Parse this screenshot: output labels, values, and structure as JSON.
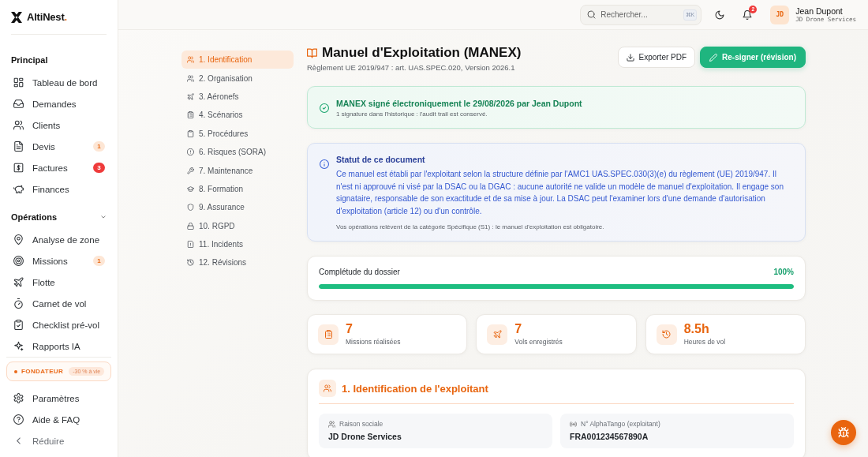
{
  "sidebar": {
    "logo": {
      "name": "AltiNest",
      "dot": "."
    },
    "sections": [
      {
        "title": "Principal",
        "items": [
          {
            "label": "Tableau de bord",
            "selected": false
          },
          {
            "label": "Demandes",
            "selected": false
          },
          {
            "label": "Clients",
            "selected": false
          },
          {
            "label": "Devis",
            "selected": false,
            "badge": {
              "text": "1",
              "color": "#fde6d5"
            }
          },
          {
            "label": "Factures",
            "selected": false,
            "badge": {
              "text": "3",
              "color": "#ef3b3b"
            }
          },
          {
            "label": "Finances",
            "selected": false
          }
        ]
      },
      {
        "title": "Opérations",
        "expanded": true,
        "items": [
          {
            "label": "Analyse de zone",
            "selected": false
          },
          {
            "label": "Missions",
            "selected": false,
            "badge": {
              "text": "1",
              "color": "#fde6d5"
            }
          },
          {
            "label": "Flotte",
            "selected": false
          },
          {
            "label": "Carnet de vol",
            "selected": false
          },
          {
            "label": "Checklist pré-vol",
            "selected": false
          },
          {
            "label": "Rapports IA",
            "selected": false
          }
        ]
      }
    ],
    "promo": {
      "label": "FONDATEUR",
      "tag": "-30 % à vie"
    },
    "footer": [
      {
        "label": "Paramètres",
        "selected": false
      },
      {
        "label": "Aide & FAQ",
        "selected": false
      },
      {
        "label": "Réduire",
        "selected": false
      }
    ]
  },
  "topbar": {
    "search": {
      "placeholder": "Rechercher...",
      "shortcut": "⌘K"
    },
    "notifications": "2",
    "user": {
      "initials": "JD",
      "name": "Jean Dupont",
      "company": "JD Drone Services"
    }
  },
  "doc_nav": [
    {
      "label": "1. Identification",
      "selected": true
    },
    {
      "label": "2. Organisation",
      "selected": false
    },
    {
      "label": "3. Aéronefs",
      "selected": false
    },
    {
      "label": "4. Scénarios",
      "selected": false
    },
    {
      "label": "5. Procédures",
      "selected": false
    },
    {
      "label": "6. Risques (SORA)",
      "selected": false
    },
    {
      "label": "7. Maintenance",
      "selected": false
    },
    {
      "label": "8. Formation",
      "selected": false
    },
    {
      "label": "9. Assurance",
      "selected": false
    },
    {
      "label": "10. RGPD",
      "selected": false
    },
    {
      "label": "11. Incidents",
      "selected": false
    },
    {
      "label": "12. Révisions",
      "selected": false
    }
  ],
  "header": {
    "title": "Manuel d'Exploitation (MANEX)",
    "subtitle": "Règlement UE 2019/947 : art. UAS.SPEC.020, Version 2026.1",
    "buttons": [
      {
        "label": "Exporter PDF",
        "kind": "secondary"
      },
      {
        "label": "Re-signer (révision)",
        "kind": "primary"
      }
    ]
  },
  "signature_banner": {
    "title": "MANEX signé électroniquement le 29/08/2026 par Jean Dupont",
    "note": "1 signature dans l'historique : l'audit trail est conservé."
  },
  "status_notice": {
    "title": "Statut de ce document",
    "body": "Ce manuel est établi par l'exploitant selon la structure définie par l'AMC1 UAS.SPEC.030(3)(e) du règlement (UE) 2019/947. Il n'est ni approuvé ni visé par la DSAC ou la DGAC : aucune autorité ne valide un modèle de manuel d'exploitation. Il engage son signataire, responsable de son exactitude et de sa mise à jour. La DSAC peut l'examiner lors d'une demande d'autorisation d'exploitation (article 12) ou d'un contrôle.",
    "note": "Vos opérations relèvent de la catégorie Spécifique (S1) : le manuel d'exploitation est obligatoire."
  },
  "completeness": {
    "label": "Complétude du dossier",
    "reading": "100%",
    "level": 1
  },
  "stats": [
    {
      "value": "7",
      "label": "Missions réalisées"
    },
    {
      "value": "7",
      "label": "Vols enregistrés"
    },
    {
      "value": "8.5h",
      "label": "Heures de vol"
    }
  ],
  "section": {
    "title": "1. Identification de l'exploitant",
    "fields": [
      {
        "label": "Raison sociale",
        "value": "JD Drone Services"
      },
      {
        "label": "N° AlphaTango (exploitant)",
        "value": "FRA001234567890A"
      }
    ]
  }
}
